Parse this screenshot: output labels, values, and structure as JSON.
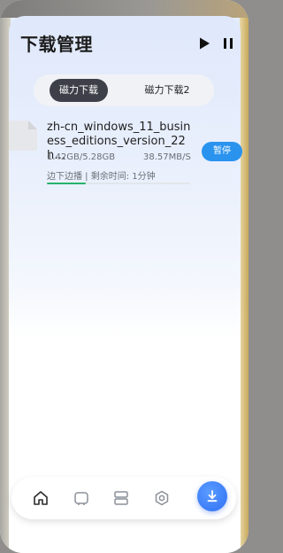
{
  "header": {
    "title": "下载管理"
  },
  "tabs": [
    {
      "label": "磁力下载",
      "active": true
    },
    {
      "label": "磁力下载2",
      "active": false
    }
  ],
  "download": {
    "file_name": "zh-cn_windows_11_business_editions_version_22h…",
    "size_progress": "1.42GB/5.28GB",
    "speed": "38.57MB/S",
    "status": "边下边播 | 剩余时间: 1分钟",
    "progress_fraction": 0.27,
    "pause_label": "暂停"
  },
  "bottom_nav": {
    "items": [
      {
        "icon": "home-icon"
      },
      {
        "icon": "tv-icon"
      },
      {
        "icon": "storage-icon"
      },
      {
        "icon": "settings-icon"
      },
      {
        "icon": "download-icon"
      }
    ]
  },
  "colors": {
    "accent_blue": "#2a93ee",
    "progress_green": "#27b36b",
    "tab_active_bg": "#3d4048"
  }
}
